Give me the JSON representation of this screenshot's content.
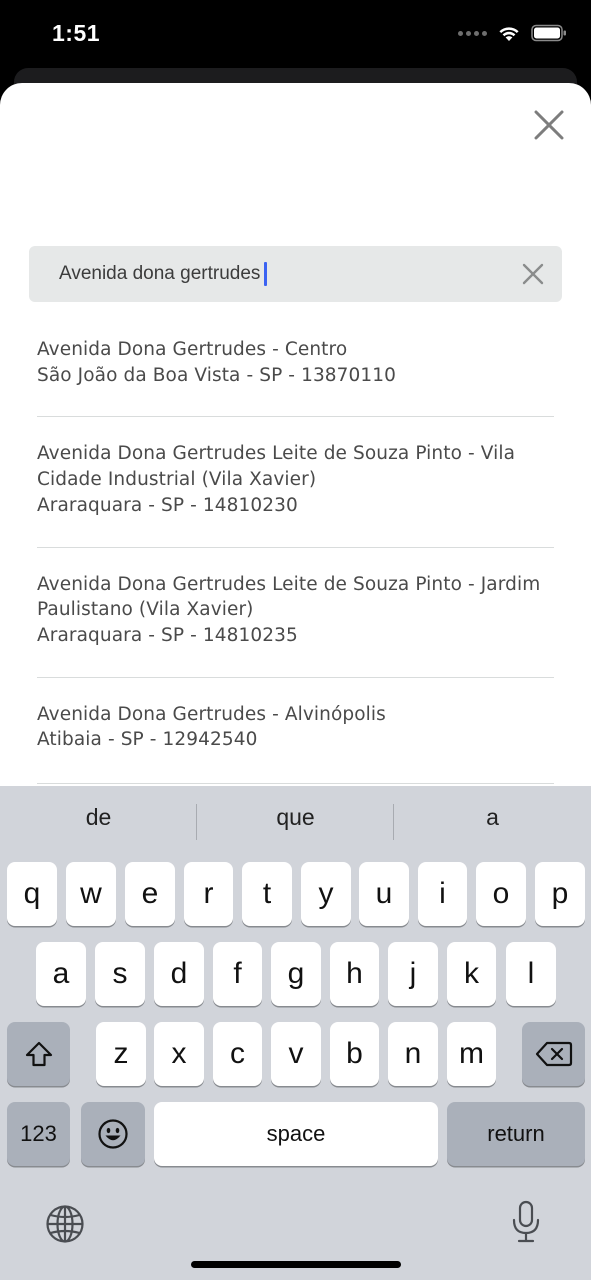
{
  "status_bar": {
    "time": "1:51"
  },
  "search": {
    "value": "Avenida dona gertrudes"
  },
  "results": [
    {
      "lines": [
        "Avenida Dona Gertrudes - Centro",
        "São João da Boa Vista - SP - 13870110"
      ]
    },
    {
      "lines": [
        "Avenida Dona Gertrudes Leite de Souza Pinto - Vila",
        "Cidade Industrial (Vila Xavier)",
        "Araraquara - SP - 14810230"
      ]
    },
    {
      "lines": [
        "Avenida Dona Gertrudes Leite de Souza Pinto - Jardim",
        "Paulistano (Vila Xavier)",
        "Araraquara - SP - 14810235"
      ]
    },
    {
      "lines": [
        "Avenida Dona Gertrudes - Alvinópolis",
        "Atibaia - SP - 12942540"
      ]
    }
  ],
  "keyboard": {
    "suggestions": [
      "de",
      "que",
      "a"
    ],
    "row1": [
      "q",
      "w",
      "e",
      "r",
      "t",
      "y",
      "u",
      "i",
      "o",
      "p"
    ],
    "row2": [
      "a",
      "s",
      "d",
      "f",
      "g",
      "h",
      "j",
      "k",
      "l"
    ],
    "row3": [
      "z",
      "x",
      "c",
      "v",
      "b",
      "n",
      "m"
    ],
    "numbers_label": "123",
    "space_label": "space",
    "return_label": "return"
  },
  "colors": {
    "caret": "#3b63f2",
    "keyboard_bg": "#d1d4da",
    "key_dark": "#aab0ba"
  }
}
